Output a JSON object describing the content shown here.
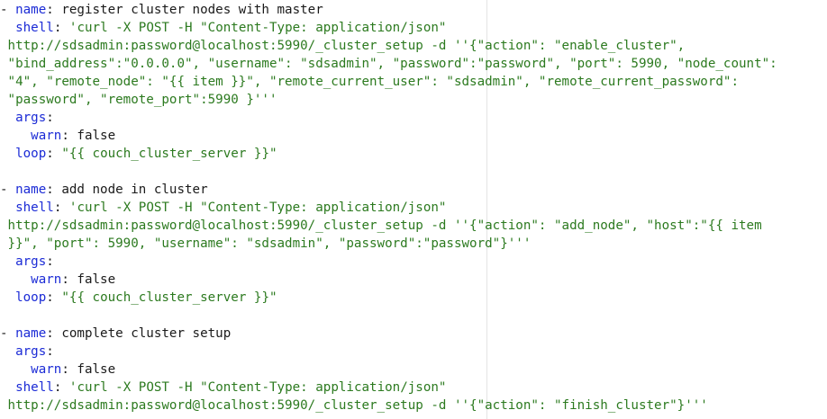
{
  "editor": {
    "lines": [
      [
        {
          "t": "txt",
          "v": "- "
        },
        {
          "t": "key",
          "v": "name"
        },
        {
          "t": "txt",
          "v": ": register cluster nodes with master"
        }
      ],
      [
        {
          "t": "txt",
          "v": "  "
        },
        {
          "t": "key",
          "v": "shell"
        },
        {
          "t": "txt",
          "v": ": "
        },
        {
          "t": "str",
          "v": "'curl -X POST -H \"Content-Type: application/json\""
        }
      ],
      [
        {
          "t": "str",
          "v": " http://sdsadmin:password@localhost:5990/_cluster_setup -d ''{\"action\": \"enable_cluster\","
        }
      ],
      [
        {
          "t": "str",
          "v": " \"bind_address\":\"0.0.0.0\", \"username\": \"sdsadmin\", \"password\":\"password\", \"port\": 5990, \"node_count\":"
        }
      ],
      [
        {
          "t": "str",
          "v": " \"4\", \"remote_node\": \"{{ item }}\", \"remote_current_user\": \"sdsadmin\", \"remote_current_password\":"
        }
      ],
      [
        {
          "t": "str",
          "v": " \"password\", \"remote_port\":5990 }'''"
        }
      ],
      [
        {
          "t": "txt",
          "v": "  "
        },
        {
          "t": "key",
          "v": "args"
        },
        {
          "t": "txt",
          "v": ":"
        }
      ],
      [
        {
          "t": "txt",
          "v": "    "
        },
        {
          "t": "key",
          "v": "warn"
        },
        {
          "t": "txt",
          "v": ": false"
        }
      ],
      [
        {
          "t": "txt",
          "v": "  "
        },
        {
          "t": "key",
          "v": "loop"
        },
        {
          "t": "txt",
          "v": ": "
        },
        {
          "t": "str",
          "v": "\"{{ couch_cluster_server }}\""
        }
      ],
      [],
      [
        {
          "t": "txt",
          "v": "- "
        },
        {
          "t": "key",
          "v": "name"
        },
        {
          "t": "txt",
          "v": ": add node in cluster"
        }
      ],
      [
        {
          "t": "txt",
          "v": "  "
        },
        {
          "t": "key",
          "v": "shell"
        },
        {
          "t": "txt",
          "v": ": "
        },
        {
          "t": "str",
          "v": "'curl -X POST -H \"Content-Type: application/json\""
        }
      ],
      [
        {
          "t": "str",
          "v": " http://sdsadmin:password@localhost:5990/_cluster_setup -d ''{\"action\": \"add_node\", \"host\":\"{{ item"
        }
      ],
      [
        {
          "t": "str",
          "v": " }}\", \"port\": 5990, \"username\": \"sdsadmin\", \"password\":\"password\"}'''"
        }
      ],
      [
        {
          "t": "txt",
          "v": "  "
        },
        {
          "t": "key",
          "v": "args"
        },
        {
          "t": "txt",
          "v": ":"
        }
      ],
      [
        {
          "t": "txt",
          "v": "    "
        },
        {
          "t": "key",
          "v": "warn"
        },
        {
          "t": "txt",
          "v": ": false"
        }
      ],
      [
        {
          "t": "txt",
          "v": "  "
        },
        {
          "t": "key",
          "v": "loop"
        },
        {
          "t": "txt",
          "v": ": "
        },
        {
          "t": "str",
          "v": "\"{{ couch_cluster_server }}\""
        }
      ],
      [],
      [
        {
          "t": "txt",
          "v": "- "
        },
        {
          "t": "key",
          "v": "name"
        },
        {
          "t": "txt",
          "v": ": complete cluster setup"
        }
      ],
      [
        {
          "t": "txt",
          "v": "  "
        },
        {
          "t": "key",
          "v": "args"
        },
        {
          "t": "txt",
          "v": ":"
        }
      ],
      [
        {
          "t": "txt",
          "v": "    "
        },
        {
          "t": "key",
          "v": "warn"
        },
        {
          "t": "txt",
          "v": ": false"
        }
      ],
      [
        {
          "t": "txt",
          "v": "  "
        },
        {
          "t": "key",
          "v": "shell"
        },
        {
          "t": "txt",
          "v": ": "
        },
        {
          "t": "str",
          "v": "'curl -X POST -H \"Content-Type: application/json\""
        }
      ],
      [
        {
          "t": "str",
          "v": " http://sdsadmin:password@localhost:5990/_cluster_setup -d ''{\"action\": \"finish_cluster\"}'''"
        }
      ]
    ]
  },
  "colors": {
    "key": "#1b2bd6",
    "string": "#2c7a1f",
    "text": "#1a1a1a",
    "background": "#ffffff"
  }
}
